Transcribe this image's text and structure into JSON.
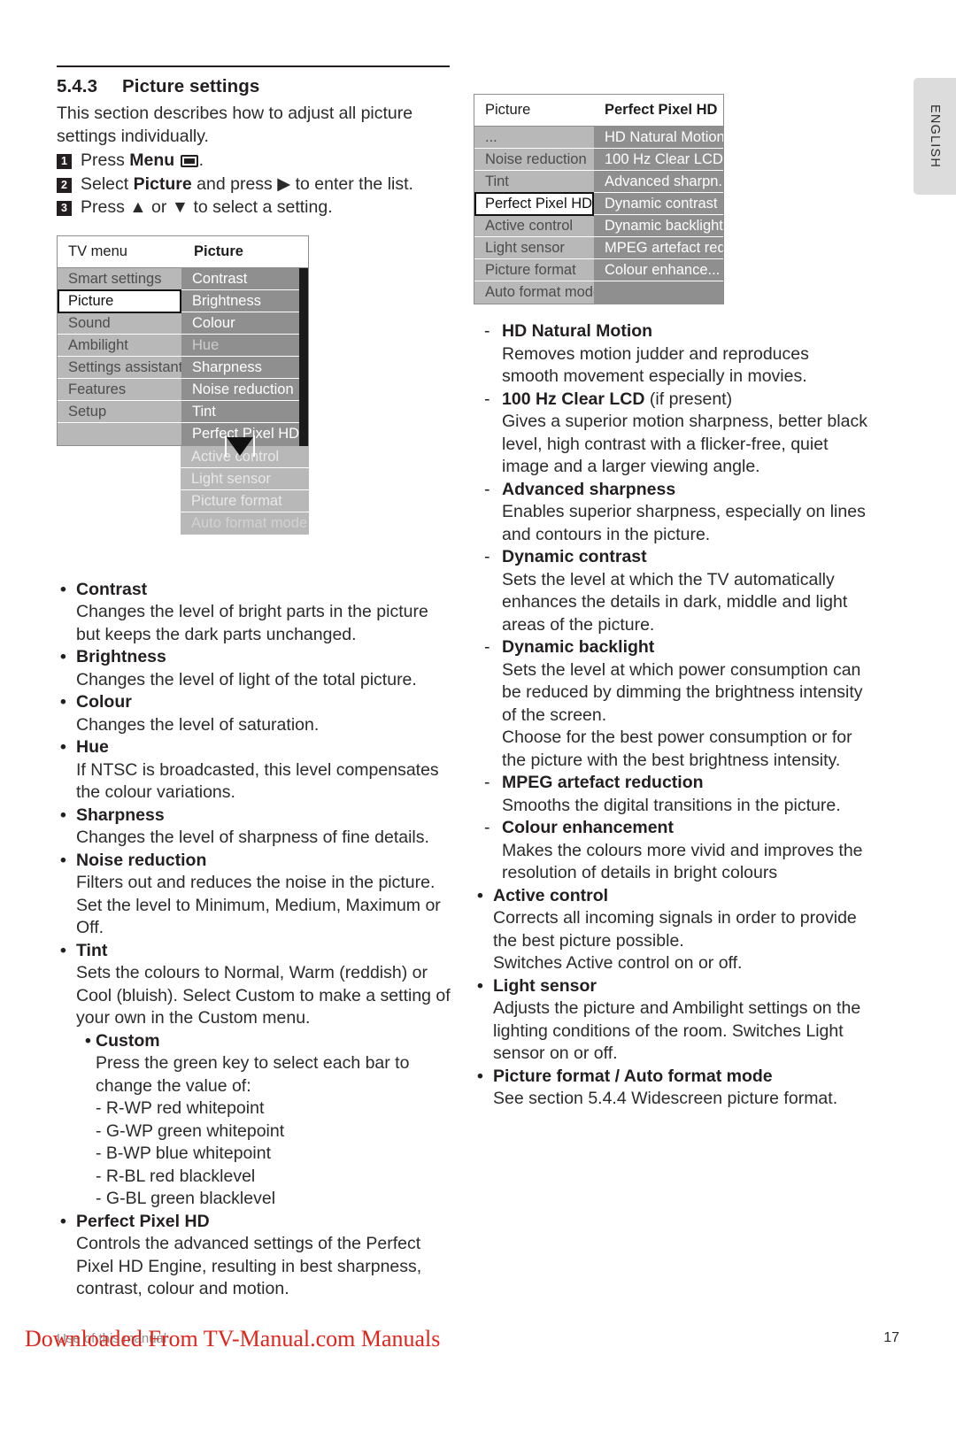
{
  "page": {
    "language_tab": "ENGLISH",
    "page_number": "17",
    "footer_note": "Use of this manual",
    "watermark": "Downloaded From TV-Manual.com Manuals"
  },
  "left": {
    "section_number": "5.4.3",
    "section_title": "Picture settings",
    "intro_line1": "This section describes how to adjust all picture",
    "intro_line2": "settings individually.",
    "steps": [
      {
        "num": "1",
        "pre": "Press ",
        "bold": "Menu",
        "post": "."
      },
      {
        "num": "2",
        "pre": "Select ",
        "bold": "Picture",
        "post": " and press ▶ to enter the list."
      },
      {
        "num": "3",
        "pre": "Press ▲ or ▼ to select a setting.",
        "bold": "",
        "post": ""
      }
    ],
    "menu": {
      "head_left": "TV menu",
      "head_right": "Picture",
      "left_items": [
        "Smart settings",
        "Picture",
        "Sound",
        "Ambilight",
        "Settings assistant",
        "Features",
        "Setup"
      ],
      "left_selected": "Picture",
      "right_items": [
        "Contrast",
        "Brightness",
        "Colour",
        "Hue",
        "Sharpness",
        "Noise reduction",
        "Tint",
        "Perfect Pixel HD",
        "Active control",
        "Light sensor",
        "Picture format",
        "Auto format mode"
      ],
      "right_greyed": "Hue"
    },
    "bullets": [
      {
        "title": "Contrast",
        "lines": [
          "Changes the level of bright parts in the picture",
          "but keeps the dark parts unchanged."
        ]
      },
      {
        "title": "Brightness",
        "lines": [
          "Changes the level of light of the total picture."
        ]
      },
      {
        "title": "Colour",
        "lines": [
          "Changes the level of saturation."
        ]
      },
      {
        "title": "Hue",
        "lines": [
          "If NTSC is broadcasted, this level compensates",
          "the colour variations."
        ]
      },
      {
        "title": "Sharpness",
        "lines": [
          "Changes the level of sharpness of fine details."
        ]
      },
      {
        "title": "Noise reduction",
        "lines": [
          "Filters out and reduces the noise in the picture.",
          "Set the level to Minimum, Medium, Maximum or",
          "Off."
        ]
      },
      {
        "title": "Tint",
        "lines": [
          "Sets the colours to Normal, Warm (reddish) or",
          "Cool (bluish). Select Custom to make a setting of",
          "your own in the Custom menu."
        ],
        "nested": {
          "title": "Custom",
          "lines": [
            "Press the green key to select each bar to",
            "change the value of:"
          ],
          "items": [
            "- R-WP red whitepoint",
            "- G-WP green whitepoint",
            "- B-WP blue whitepoint",
            "- R-BL red blacklevel",
            "- G-BL green blacklevel"
          ]
        }
      },
      {
        "title": "Perfect Pixel HD",
        "lines": [
          "Controls the advanced settings of the Perfect",
          "Pixel HD Engine, resulting in best sharpness,",
          "contrast, colour and motion."
        ]
      }
    ]
  },
  "right": {
    "menu": {
      "head_left": "Picture",
      "head_right": "Perfect Pixel HD",
      "left_items": [
        "...",
        "Noise reduction",
        "Tint",
        "Perfect Pixel HD",
        "Active control",
        "Light sensor",
        "Picture format",
        "Auto format mode"
      ],
      "left_selected": "Perfect Pixel HD",
      "right_items": [
        "HD Natural Motion",
        "100 Hz Clear LCD",
        "Advanced sharpn...",
        "Dynamic contrast",
        "Dynamic backlight",
        "MPEG artefact red...",
        "Colour enhance...",
        ""
      ]
    },
    "dash_items": [
      {
        "title": "HD Natural Motion",
        "suffix": "",
        "lines": [
          "Removes motion judder and reproduces",
          "smooth movement especially in movies."
        ]
      },
      {
        "title": "100 Hz Clear LCD",
        "suffix": " (if present)",
        "lines": [
          "Gives a superior motion sharpness, better black",
          "level, high contrast with a flicker-free, quiet",
          "image and a larger viewing angle."
        ]
      },
      {
        "title": "Advanced sharpness",
        "suffix": "",
        "lines": [
          "Enables superior sharpness, especially on lines",
          "and contours in the picture."
        ]
      },
      {
        "title": "Dynamic contrast",
        "suffix": "",
        "lines": [
          "Sets the level at which the TV automatically",
          "enhances the details in dark, middle and light",
          "areas of the picture."
        ]
      },
      {
        "title": "Dynamic backlight",
        "suffix": "",
        "lines": [
          "Sets the level at which power consumption can",
          "be reduced by dimming the brightness intensity",
          "of the screen.",
          "Choose for the best power consumption or for",
          "the picture with the best brightness intensity."
        ]
      },
      {
        "title": "MPEG artefact reduction",
        "suffix": "",
        "lines": [
          "Smooths the digital transitions in the picture."
        ]
      },
      {
        "title": "Colour enhancement",
        "suffix": "",
        "lines": [
          "Makes the colours more vivid and improves the",
          "resolution of details in bright colours"
        ]
      }
    ],
    "bullets": [
      {
        "title": "Active control",
        "lines": [
          "Corrects all incoming signals in order to provide",
          "the best picture possible.",
          "Switches Active control on or off."
        ]
      },
      {
        "title": "Light sensor",
        "lines": [
          "Adjusts the picture and Ambilight settings on the",
          "lighting conditions of the room. Switches Light",
          "sensor on or off."
        ]
      },
      {
        "title": "Picture format / Auto format mode",
        "lines": [],
        "ref_line": {
          "pre": "See section ",
          "bold": "5.4.4 Widescreen picture format",
          "post": "."
        }
      }
    ]
  }
}
